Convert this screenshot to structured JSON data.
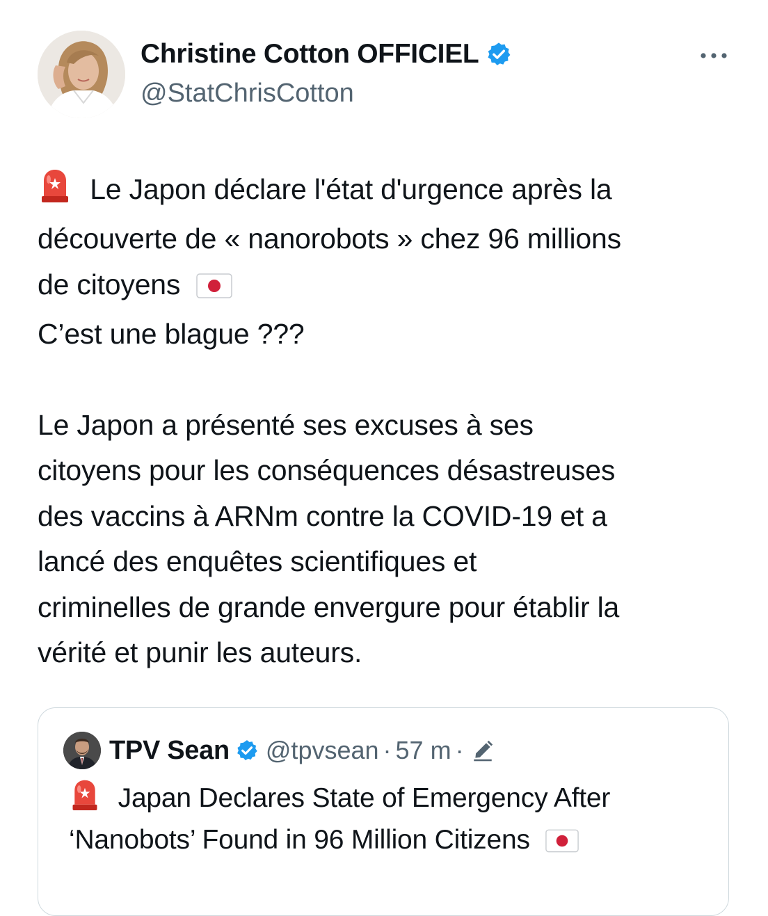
{
  "author": {
    "display_name": "Christine Cotton OFFICIEL",
    "handle": "@StatChrisCotton",
    "verified": true
  },
  "tweet": {
    "line1": "Le Japon déclare l'état d'urgence après la",
    "line2": "découverte de « nanorobots » chez 96 millions",
    "line3": "de citoyens",
    "line4": "C’est une blague ???",
    "para2_line1": "Le Japon a présenté ses excuses à ses",
    "para2_line2": "citoyens pour les conséquences désastreuses",
    "para2_line3": "des vaccins à ARNm contre la COVID-19 et a",
    "para2_line4": "lancé des enquêtes scientifiques et",
    "para2_line5": "criminelles de grande envergure pour établir la",
    "para2_line6": "vérité et punir les auteurs."
  },
  "quoted": {
    "display_name": "TPV Sean",
    "handle": "@tpvsean",
    "separator": "·",
    "time": "57 m",
    "verified": true,
    "line1": "Japan Declares State of Emergency After",
    "line2": "‘Nanobots’ Found in 96 Million Citizens"
  },
  "icons": {
    "alert": "rotating-light-icon",
    "flag": "japan-flag-icon",
    "verified": "verified-badge-icon",
    "more": "more-dots-icon",
    "edit": "edit-pencil-icon"
  },
  "colors": {
    "verified_blue": "#1d9bf0",
    "secondary_text": "#536471",
    "primary_text": "#0f1419",
    "border": "#cfd9de"
  }
}
